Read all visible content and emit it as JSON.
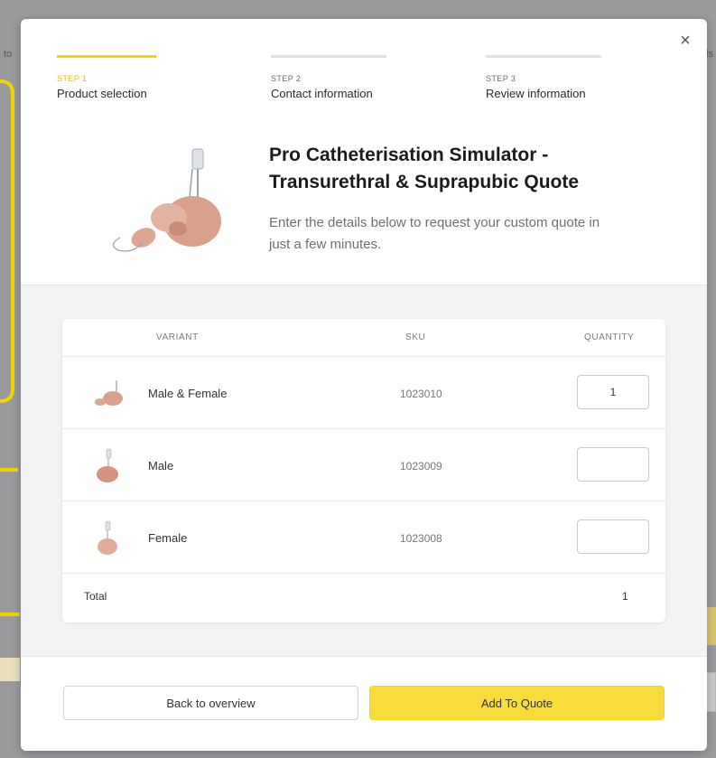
{
  "background": {
    "left_text": "to",
    "right_text": "ls"
  },
  "modal": {
    "close_label": "×",
    "steps": [
      {
        "number": "STEP 1",
        "label": "Product selection",
        "active": true
      },
      {
        "number": "STEP 2",
        "label": "Contact information",
        "active": false
      },
      {
        "number": "STEP 3",
        "label": "Review information",
        "active": false
      }
    ],
    "product": {
      "title_line1": "Pro Catheterisation Simulator -",
      "title_line2": "Transurethral & Suprapubic Quote",
      "subtitle_line1": "Enter the details below to request your custom quote in",
      "subtitle_line2": "just a few minutes."
    },
    "table": {
      "headers": {
        "variant": "VARIANT",
        "sku": "SKU",
        "quantity": "QUANTITY"
      },
      "rows": [
        {
          "variant": "Male & Female",
          "sku": "1023010",
          "quantity": "1"
        },
        {
          "variant": "Male",
          "sku": "1023009",
          "quantity": ""
        },
        {
          "variant": "Female",
          "sku": "1023008",
          "quantity": ""
        }
      ],
      "total_label": "Total",
      "total_value": "1"
    },
    "buttons": {
      "back": "Back to overview",
      "add": "Add To Quote"
    }
  },
  "colors": {
    "accent": "#f5d400",
    "button_primary": "#f7dc3a",
    "overlay": "#8d8d90"
  }
}
